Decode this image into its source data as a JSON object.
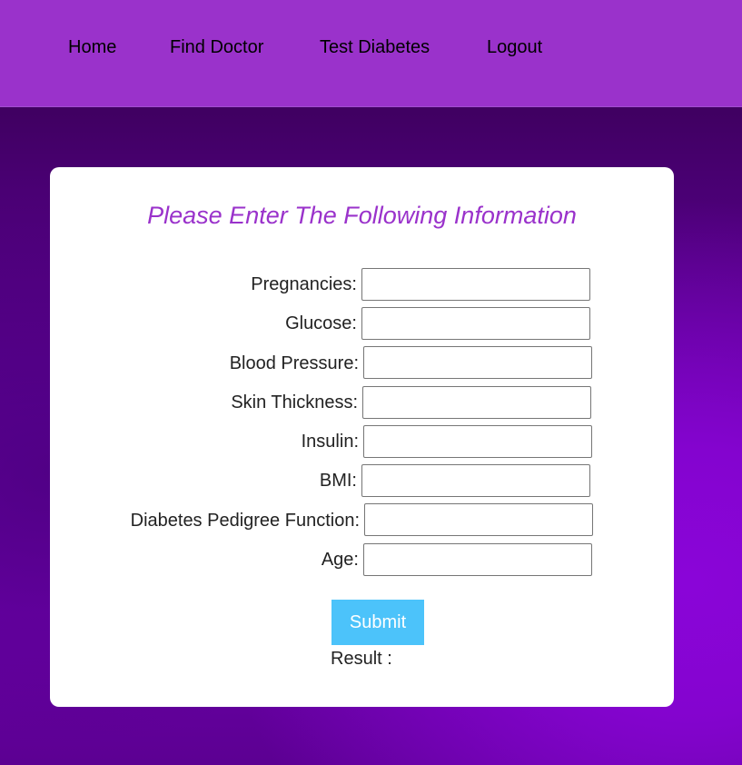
{
  "nav": {
    "items": [
      {
        "label": "Home"
      },
      {
        "label": "Find Doctor"
      },
      {
        "label": "Test Diabetes"
      },
      {
        "label": "Logout"
      }
    ]
  },
  "form": {
    "title": "Please Enter The Following Information",
    "fields": [
      {
        "label": "Pregnancies:",
        "value": ""
      },
      {
        "label": "Glucose:",
        "value": ""
      },
      {
        "label": "Blood Pressure:",
        "value": ""
      },
      {
        "label": "Skin Thickness:",
        "value": ""
      },
      {
        "label": "Insulin:",
        "value": ""
      },
      {
        "label": "BMI:",
        "value": ""
      },
      {
        "label": "Diabetes Pedigree Function:",
        "value": ""
      },
      {
        "label": "Age:",
        "value": ""
      }
    ],
    "submit_label": "Submit",
    "result_label": "Result :"
  },
  "colors": {
    "navbar": "#9a32cb",
    "title": "#9a32cb",
    "submit": "#4cc3fa",
    "background": "#5e0096"
  }
}
